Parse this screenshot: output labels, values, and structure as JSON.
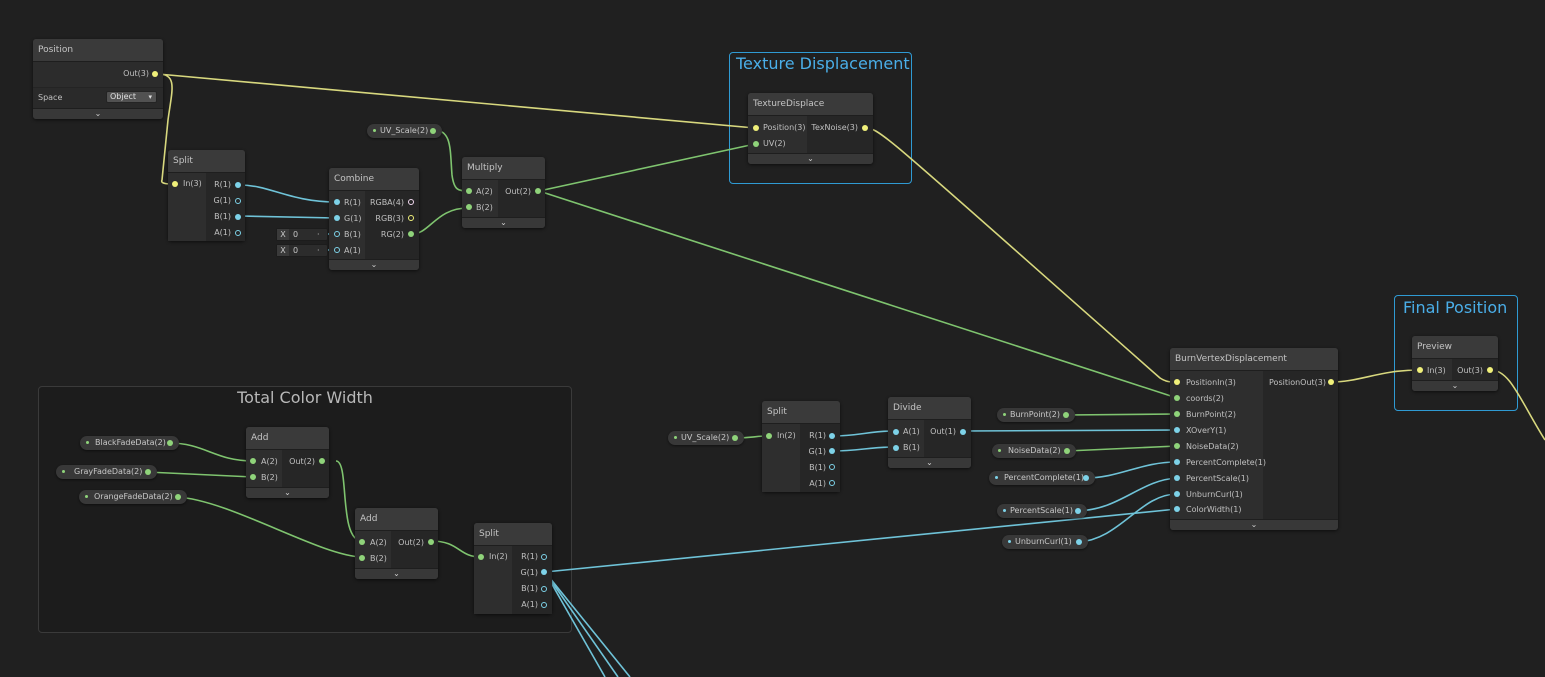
{
  "colors": {
    "background": "#202020",
    "node_body": "#2c2c2c",
    "node_header": "#3a3a3a",
    "group_border_blue": "#2f9ad3",
    "group_title_blue": "#4aaee8",
    "wire_vector1": "#7dd2e8",
    "wire_vector2": "#8fd37a",
    "wire_vector3": "#e4e48a"
  },
  "groups": {
    "texture_displacement": {
      "title": "Texture Displacement"
    },
    "final_position": {
      "title": "Final Position"
    },
    "total_color_width": {
      "title": "Total Color Width"
    }
  },
  "nodes": {
    "position": {
      "title": "Position",
      "out": "Out(3)",
      "space_label": "Space",
      "space_value": "Object",
      "collapse_icon": "chevron-down"
    },
    "split1": {
      "title": "Split",
      "in": [
        "In(3)"
      ],
      "out": [
        "R(1)",
        "G(1)",
        "B(1)",
        "A(1)"
      ]
    },
    "combine": {
      "title": "Combine",
      "in": [
        "R(1)",
        "G(1)",
        "B(1)",
        "A(1)"
      ],
      "out": [
        "RGBA(4)",
        "RGB(3)",
        "RG(2)"
      ],
      "b_field": {
        "label": "X",
        "value": "0"
      },
      "a_field": {
        "label": "X",
        "value": "0"
      }
    },
    "multiply": {
      "title": "Multiply",
      "in": [
        "A(2)",
        "B(2)"
      ],
      "out": [
        "Out(2)"
      ]
    },
    "texture_displace": {
      "title": "TextureDisplace",
      "in": [
        "Position(3)",
        "UV(2)"
      ],
      "out": [
        "TexNoise(3)"
      ]
    },
    "burn_vertex": {
      "title": "BurnVertexDisplacement",
      "in": [
        "PositionIn(3)",
        "coords(2)",
        "BurnPoint(2)",
        "XOverY(1)",
        "NoiseData(2)",
        "PercentComplete(1)",
        "PercentScale(1)",
        "UnburnCurl(1)",
        "ColorWidth(1)"
      ],
      "out": [
        "PositionOut(3)"
      ]
    },
    "preview": {
      "title": "Preview",
      "in": [
        "In(3)"
      ],
      "out": [
        "Out(3)"
      ]
    },
    "split2": {
      "title": "Split",
      "in": [
        "In(2)"
      ],
      "out": [
        "R(1)",
        "G(1)",
        "B(1)",
        "A(1)"
      ]
    },
    "divide": {
      "title": "Divide",
      "in": [
        "A(1)",
        "B(1)"
      ],
      "out": [
        "Out(1)"
      ]
    },
    "add1": {
      "title": "Add",
      "in": [
        "A(2)",
        "B(2)"
      ],
      "out": [
        "Out(2)"
      ]
    },
    "add2": {
      "title": "Add",
      "in": [
        "A(2)",
        "B(2)"
      ],
      "out": [
        "Out(2)"
      ]
    },
    "split3": {
      "title": "Split",
      "in": [
        "In(2)"
      ],
      "out": [
        "R(1)",
        "G(1)",
        "B(1)",
        "A(1)"
      ]
    }
  },
  "properties": {
    "uv_scale_1": "UV_Scale(2)",
    "uv_scale_2": "UV_Scale(2)",
    "burn_point": "BurnPoint(2)",
    "noise_data": "NoiseData(2)",
    "percent_complete": "PercentComplete(1)",
    "percent_scale": "PercentScale(1)",
    "unburn_curl": "UnburnCurl(1)",
    "black_fade": "BlackFadeData(2)",
    "gray_fade": "GrayFadeData(2)",
    "orange_fade": "OrangeFadeData(2)"
  },
  "icons": {
    "collapse": "⌄",
    "dropdown_arrow": "▾",
    "dot_sep": "·"
  }
}
